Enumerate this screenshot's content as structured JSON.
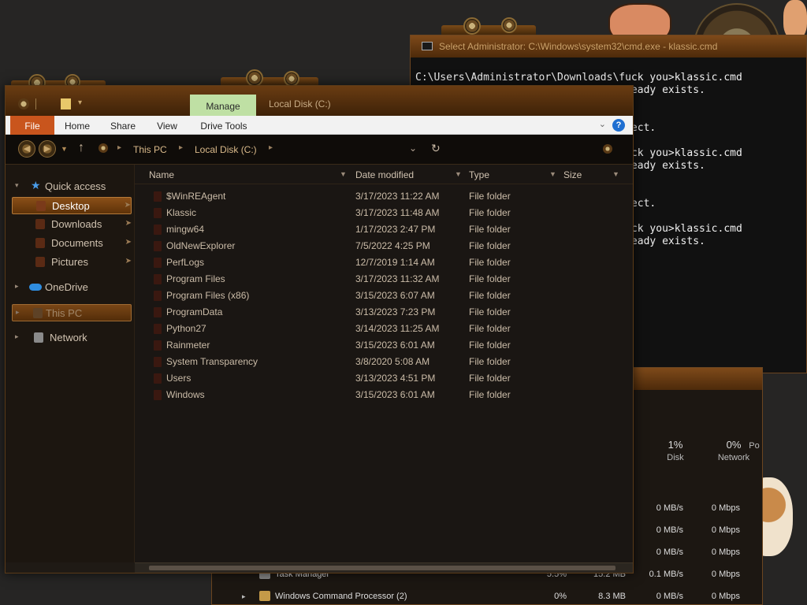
{
  "colors": {
    "accent": "#c9551d",
    "manage_tab": "#bfe0a4",
    "help": "#1f6fd1",
    "frame": "#6a3c12"
  },
  "cmd": {
    "title": "Select Administrator: C:\\Windows\\system32\\cmd.exe - klassic.cmd",
    "lines": [
      "C:\\Users\\Administrator\\Downloads\\fuck you>klassic.cmd",
      "A subdirectory or file \\Klassic already exists.",
      "",
      "",
      "The syntax of the command is incorrect.",
      "",
      "C:\\Users\\Administrator\\Downloads\\fuck you>klassic.cmd",
      "A subdirectory or file \\Klassic already exists.",
      "",
      "",
      "The syntax of the command is incorrect.",
      "",
      "C:\\Users\\Administrator\\Downloads\\fuck you>klassic.cmd",
      "A subdirectory or file \\Klassic already exists."
    ]
  },
  "taskmgr": {
    "stats": [
      {
        "pct": "1%",
        "label": "Disk"
      },
      {
        "pct": "0%",
        "label": "Network"
      },
      {
        "pct": "",
        "label": "Po"
      }
    ],
    "rows": [
      {
        "name": "",
        "cpu": "",
        "mem": "",
        "disk": "0 MB/s",
        "net": "0 Mbps"
      },
      {
        "name": "",
        "cpu": "",
        "mem": "",
        "disk": "0 MB/s",
        "net": "0 Mbps"
      },
      {
        "name": "",
        "cpu": "",
        "mem": "",
        "disk": "0 MB/s",
        "net": "0 Mbps"
      },
      {
        "name": "Task Manager",
        "cpu": "5.5%",
        "mem": "15.2 MB",
        "disk": "0.1 MB/s",
        "net": "0 Mbps"
      },
      {
        "name": "Windows Command Processor (2)",
        "cpu": "0%",
        "mem": "8.3 MB",
        "disk": "0 MB/s",
        "net": "0 Mbps"
      }
    ]
  },
  "explorer": {
    "context_tab": "Manage",
    "window_title": "Local Disk (C:)",
    "ribbon_tabs": [
      "File",
      "Home",
      "Share",
      "View",
      "Drive Tools"
    ],
    "help_glyph": "?",
    "breadcrumb": [
      "This PC",
      "Local Disk (C:)"
    ],
    "nav": {
      "quick_access": "Quick access",
      "items": [
        "Desktop",
        "Downloads",
        "Documents",
        "Pictures"
      ],
      "onedrive": "OneDrive",
      "this_pc": "This PC",
      "network": "Network"
    },
    "columns": {
      "name": "Name",
      "date": "Date modified",
      "type": "Type",
      "size": "Size"
    },
    "files": [
      {
        "name": "$WinREAgent",
        "date": "3/17/2023 11:22 AM",
        "type": "File folder"
      },
      {
        "name": "Klassic",
        "date": "3/17/2023 11:48 AM",
        "type": "File folder"
      },
      {
        "name": "mingw64",
        "date": "1/17/2023 2:47 PM",
        "type": "File folder"
      },
      {
        "name": "OldNewExplorer",
        "date": "7/5/2022 4:25 PM",
        "type": "File folder"
      },
      {
        "name": "PerfLogs",
        "date": "12/7/2019 1:14 AM",
        "type": "File folder"
      },
      {
        "name": "Program Files",
        "date": "3/17/2023 11:32 AM",
        "type": "File folder"
      },
      {
        "name": "Program Files (x86)",
        "date": "3/15/2023 6:07 AM",
        "type": "File folder"
      },
      {
        "name": "ProgramData",
        "date": "3/13/2023 7:23 PM",
        "type": "File folder"
      },
      {
        "name": "Python27",
        "date": "3/14/2023 11:25 AM",
        "type": "File folder"
      },
      {
        "name": "Rainmeter",
        "date": "3/15/2023 6:01 AM",
        "type": "File folder"
      },
      {
        "name": "System Transparency",
        "date": "3/8/2020 5:08 AM",
        "type": "File folder"
      },
      {
        "name": "Users",
        "date": "3/13/2023 4:51 PM",
        "type": "File folder"
      },
      {
        "name": "Windows",
        "date": "3/15/2023 6:01 AM",
        "type": "File folder"
      }
    ]
  }
}
